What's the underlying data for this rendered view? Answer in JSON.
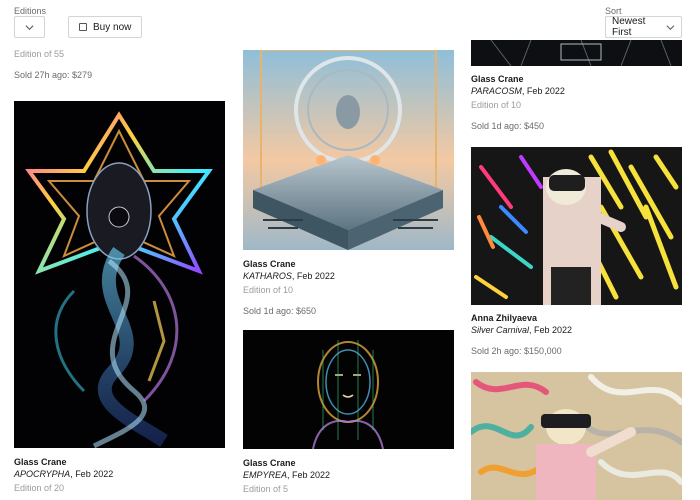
{
  "filters": {
    "editions_label": "Editions",
    "buy_now_label": "Buy now",
    "sort_label": "Sort",
    "sort_value": "Newest First"
  },
  "column1": {
    "top_card": {
      "title_fragment": "...",
      "edition": "Edition of 55",
      "sold": "Sold 27h ago: $279"
    },
    "apocrypha": {
      "artist": "Glass Crane",
      "title": "APOCRYPHA",
      "date": ", Feb 2022",
      "edition": "Edition of 20"
    }
  },
  "column2": {
    "katharos": {
      "artist": "Glass Crane",
      "title": "KATHAROS",
      "date": ", Feb 2022",
      "edition": "Edition of 10",
      "sold": "Sold 1d ago: $650"
    },
    "empyrea": {
      "artist": "Glass Crane",
      "title": "EMPYREA",
      "date": ", Feb 2022",
      "edition": "Edition of 5"
    }
  },
  "column3": {
    "paracosm": {
      "artist": "Glass Crane",
      "title": "PARACOSM",
      "date": ", Feb 2022",
      "edition": "Edition of 10",
      "sold": "Sold 1d ago: $450"
    },
    "silver_carnival": {
      "artist": "Anna Zhilyaeva",
      "title": "Silver Carnival",
      "date": ", Feb 2022",
      "sold": "Sold 2h ago: $150,000"
    }
  }
}
